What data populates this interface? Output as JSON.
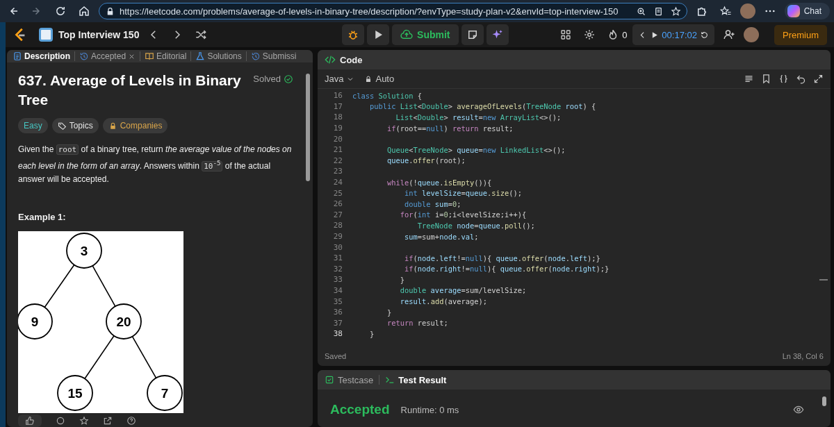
{
  "browser": {
    "url": "https://leetcode.com/problems/average-of-levels-in-binary-tree/description/?envType=study-plan-v2&envId=top-interview-150",
    "chat_label": "Chat"
  },
  "nav": {
    "study_plan": "Top Interview 150",
    "submit_label": "Submit",
    "streak": "0",
    "timer": "00:17:02",
    "premium_label": "Premium"
  },
  "left_tabs": [
    {
      "label": "Description",
      "selected": true,
      "closable": false
    },
    {
      "label": "Accepted",
      "selected": false,
      "closable": true
    },
    {
      "label": "Editorial",
      "selected": false,
      "closable": false
    },
    {
      "label": "Solutions",
      "selected": false,
      "closable": false
    },
    {
      "label": "Submissi",
      "selected": false,
      "closable": false
    }
  ],
  "problem": {
    "title": "637. Average of Levels in Binary Tree",
    "status": "Solved",
    "tags": [
      {
        "kind": "difficulty",
        "label": "Easy"
      },
      {
        "kind": "topics",
        "label": "Topics"
      },
      {
        "kind": "companies",
        "label": "Companies"
      }
    ],
    "description": [
      {
        "kind": "text",
        "t": "Given the "
      },
      {
        "kind": "code",
        "t": "root"
      },
      {
        "kind": "text",
        "t": " of a binary tree, return *the average value of the nodes on each level in the form of an array*. Answers within "
      },
      {
        "kind": "code",
        "t": "10$^{-5}$"
      },
      {
        "kind": "text",
        "t": " of the actual answer will be accepted."
      }
    ],
    "example_heading": "Example 1:",
    "example_tree": {
      "nodes": [
        "3",
        "9",
        "20",
        "15",
        "7"
      ]
    }
  },
  "code_panel": {
    "title": "Code",
    "language": "Java",
    "mode": "Auto",
    "status": "Saved",
    "cursor": "Ln 38, Col 6",
    "lines": [
      {
        "n": "16",
        "tokens": [
          {
            "kind": "keyword",
            "text": "class"
          },
          {
            "kind": "type",
            "text": " Solution"
          },
          {
            "kind": "plain",
            "text": " {"
          }
        ]
      },
      {
        "n": "17",
        "tokens": [
          {
            "kind": "keyword",
            "text": "    public"
          },
          {
            "kind": "type",
            "text": " List"
          },
          {
            "kind": "plain",
            "text": "<"
          },
          {
            "kind": "type",
            "text": "Double"
          },
          {
            "kind": "plain",
            "text": ">"
          },
          {
            "kind": "function",
            "text": " averageOfLevels"
          },
          {
            "kind": "plain",
            "text": "("
          },
          {
            "kind": "type",
            "text": "TreeNode"
          },
          {
            "kind": "variable",
            "text": " root"
          },
          {
            "kind": "plain",
            "text": ") {"
          }
        ]
      },
      {
        "n": "18",
        "tokens": [
          {
            "kind": "type",
            "text": "          List"
          },
          {
            "kind": "plain",
            "text": "<"
          },
          {
            "kind": "type",
            "text": "Double"
          },
          {
            "kind": "plain",
            "text": ">"
          },
          {
            "kind": "variable",
            "text": " result"
          },
          {
            "kind": "plain",
            "text": "="
          },
          {
            "kind": "keyword",
            "text": "new"
          },
          {
            "kind": "type",
            "text": " ArrayList"
          },
          {
            "kind": "plain",
            "text": "<>();"
          }
        ]
      },
      {
        "n": "19",
        "tokens": [
          {
            "kind": "control",
            "text": "        if"
          },
          {
            "kind": "plain",
            "text": "(root=="
          },
          {
            "kind": "keyword",
            "text": "null"
          },
          {
            "kind": "plain",
            "text": ")"
          },
          {
            "kind": "control",
            "text": " return"
          },
          {
            "kind": "plain",
            "text": " result;"
          }
        ]
      },
      {
        "n": "20"
      },
      {
        "n": "21",
        "tokens": [
          {
            "kind": "type",
            "text": "        Queue"
          },
          {
            "kind": "plain",
            "text": "<"
          },
          {
            "kind": "type",
            "text": "TreeNode"
          },
          {
            "kind": "plain",
            "text": ">"
          },
          {
            "kind": "variable",
            "text": " queue"
          },
          {
            "kind": "plain",
            "text": "="
          },
          {
            "kind": "keyword",
            "text": "new"
          },
          {
            "kind": "type",
            "text": " LinkedList"
          },
          {
            "kind": "plain",
            "text": "<>();"
          }
        ]
      },
      {
        "n": "22",
        "tokens": [
          {
            "kind": "variable",
            "text": "        queue"
          },
          {
            "kind": "plain",
            "text": "."
          },
          {
            "kind": "function",
            "text": "offer"
          },
          {
            "kind": "plain",
            "text": "(root);"
          }
        ]
      },
      {
        "n": "23"
      },
      {
        "n": "24",
        "tokens": [
          {
            "kind": "control",
            "text": "        while"
          },
          {
            "kind": "plain",
            "text": "(!"
          },
          {
            "kind": "variable",
            "text": "queue"
          },
          {
            "kind": "plain",
            "text": "."
          },
          {
            "kind": "function",
            "text": "isEmpty"
          },
          {
            "kind": "plain",
            "text": "()){"
          }
        ]
      },
      {
        "n": "25",
        "tokens": [
          {
            "kind": "keyword",
            "text": "            int"
          },
          {
            "kind": "variable",
            "text": " levelSize"
          },
          {
            "kind": "plain",
            "text": "="
          },
          {
            "kind": "variable",
            "text": "queue"
          },
          {
            "kind": "plain",
            "text": "."
          },
          {
            "kind": "function",
            "text": "size"
          },
          {
            "kind": "plain",
            "text": "();"
          }
        ]
      },
      {
        "n": "26",
        "tokens": [
          {
            "kind": "keyword",
            "text": "            double"
          },
          {
            "kind": "variable",
            "text": " sum"
          },
          {
            "kind": "plain",
            "text": "="
          },
          {
            "kind": "number",
            "text": "0"
          },
          {
            "kind": "plain",
            "text": ";"
          }
        ]
      },
      {
        "n": "27",
        "tokens": [
          {
            "kind": "control",
            "text": "           for"
          },
          {
            "kind": "plain",
            "text": "("
          },
          {
            "kind": "keyword",
            "text": "int"
          },
          {
            "kind": "plain",
            "text": " i="
          },
          {
            "kind": "number",
            "text": "0"
          },
          {
            "kind": "plain",
            "text": ";i<levelSize;i++){"
          }
        ]
      },
      {
        "n": "28",
        "tokens": [
          {
            "kind": "type",
            "text": "               TreeNode"
          },
          {
            "kind": "variable",
            "text": " node"
          },
          {
            "kind": "plain",
            "text": "="
          },
          {
            "kind": "variable",
            "text": "queue"
          },
          {
            "kind": "plain",
            "text": "."
          },
          {
            "kind": "function",
            "text": "poll"
          },
          {
            "kind": "plain",
            "text": "();"
          }
        ]
      },
      {
        "n": "29",
        "tokens": [
          {
            "kind": "variable",
            "text": "            sum"
          },
          {
            "kind": "plain",
            "text": "=sum+"
          },
          {
            "kind": "variable",
            "text": "node"
          },
          {
            "kind": "plain",
            "text": "."
          },
          {
            "kind": "variable",
            "text": "val"
          },
          {
            "kind": "plain",
            "text": ";"
          }
        ]
      },
      {
        "n": "30"
      },
      {
        "n": "31",
        "tokens": [
          {
            "kind": "control",
            "text": "            if"
          },
          {
            "kind": "plain",
            "text": "("
          },
          {
            "kind": "variable",
            "text": "node"
          },
          {
            "kind": "plain",
            "text": "."
          },
          {
            "kind": "variable",
            "text": "left"
          },
          {
            "kind": "plain",
            "text": "!="
          },
          {
            "kind": "keyword",
            "text": "null"
          },
          {
            "kind": "plain",
            "text": "){"
          },
          {
            "kind": "variable",
            "text": " queue"
          },
          {
            "kind": "plain",
            "text": "."
          },
          {
            "kind": "function",
            "text": "offer"
          },
          {
            "kind": "plain",
            "text": "("
          },
          {
            "kind": "variable",
            "text": "node"
          },
          {
            "kind": "plain",
            "text": "."
          },
          {
            "kind": "variable",
            "text": "left"
          },
          {
            "kind": "plain",
            "text": ");}"
          }
        ]
      },
      {
        "n": "32",
        "tokens": [
          {
            "kind": "control",
            "text": "            if"
          },
          {
            "kind": "plain",
            "text": "("
          },
          {
            "kind": "variable",
            "text": "node"
          },
          {
            "kind": "plain",
            "text": "."
          },
          {
            "kind": "variable",
            "text": "right"
          },
          {
            "kind": "plain",
            "text": "!="
          },
          {
            "kind": "keyword",
            "text": "null"
          },
          {
            "kind": "plain",
            "text": "){"
          },
          {
            "kind": "variable",
            "text": " queue"
          },
          {
            "kind": "plain",
            "text": "."
          },
          {
            "kind": "function",
            "text": "offer"
          },
          {
            "kind": "plain",
            "text": "("
          },
          {
            "kind": "variable",
            "text": "node"
          },
          {
            "kind": "plain",
            "text": "."
          },
          {
            "kind": "variable",
            "text": "right"
          },
          {
            "kind": "plain",
            "text": ");}"
          }
        ]
      },
      {
        "n": "33",
        "tokens": [
          {
            "kind": "plain",
            "text": "           }"
          }
        ]
      },
      {
        "n": "34",
        "tokens": [
          {
            "kind": "type",
            "text": "           double"
          },
          {
            "kind": "variable",
            "text": " average"
          },
          {
            "kind": "plain",
            "text": "=sum/levelSize;"
          }
        ]
      },
      {
        "n": "35",
        "tokens": [
          {
            "kind": "variable",
            "text": "           result"
          },
          {
            "kind": "plain",
            "text": "."
          },
          {
            "kind": "function",
            "text": "add"
          },
          {
            "kind": "plain",
            "text": "(average);"
          }
        ]
      },
      {
        "n": "36",
        "tokens": [
          {
            "kind": "plain",
            "text": "        }"
          }
        ]
      },
      {
        "n": "37",
        "tokens": [
          {
            "kind": "control",
            "text": "        return"
          },
          {
            "kind": "plain",
            "text": " result;"
          }
        ]
      },
      {
        "n": "38",
        "tokens": [
          {
            "kind": "plain",
            "text": "    }"
          }
        ]
      }
    ]
  },
  "result_panel": {
    "tabs": [
      {
        "label": "Testcase",
        "selected": false
      },
      {
        "label": "Test Result",
        "selected": true
      }
    ],
    "verdict": "Accepted",
    "runtime": "Runtime: 0 ms"
  }
}
